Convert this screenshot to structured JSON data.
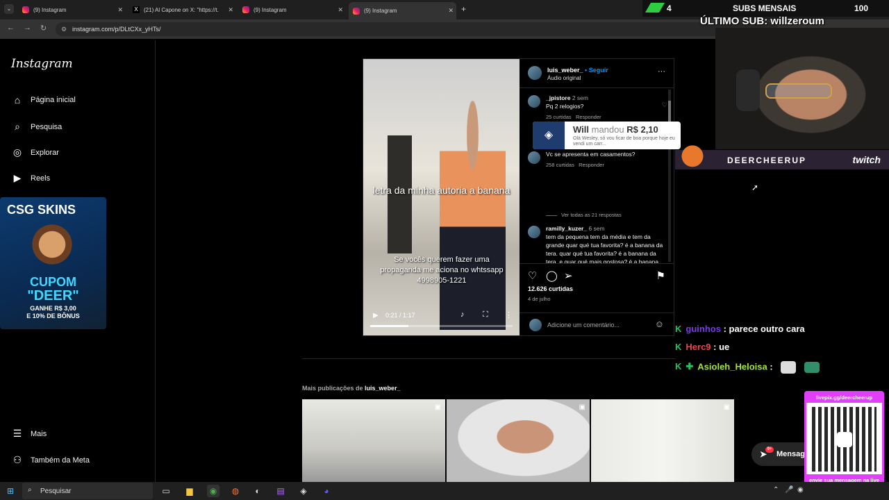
{
  "browser": {
    "tabs": [
      {
        "label": "(9) Instagram",
        "icon": "instagram-icon"
      },
      {
        "label": "(21) Al Capone on X: \"https://t.",
        "icon": "x-icon"
      },
      {
        "label": "(9) Instagram",
        "icon": "instagram-icon"
      },
      {
        "label": "(9) Instagram",
        "icon": "instagram-icon",
        "active": true
      }
    ],
    "url": "instagram.com/p/DLtCXx_yHTs/"
  },
  "overlay": {
    "subs_count": "4",
    "subs_label": "SUBS MENSAIS",
    "subs_goal": "100",
    "last_sub": "ÚLTIMO SUB: willzeroum",
    "channel": "DEERCHEERUP",
    "platform": "twitch",
    "donation": {
      "name": "Will",
      "verb": "mandou",
      "amount": "R$ 2,10",
      "message": "Olá Wesley, só vou ficar de boa porque hoje eu vendi um carr..."
    },
    "chat": [
      {
        "user": "guinhos",
        "color": "#7c3aed",
        "text": ": parece outro cara"
      },
      {
        "user": "Herc9",
        "color": "#ef4444",
        "text": ": ue"
      },
      {
        "user": "Asioleh_Heloisa",
        "color": "#a3e635",
        "text": ":"
      }
    ],
    "qr_top": "livepix.gg/deercheerup",
    "qr_bottom": "envie sua mensagem na live via pix!"
  },
  "sidebar": {
    "logo": "Instagram",
    "items": [
      {
        "label": "Página inicial",
        "icon": "home-icon"
      },
      {
        "label": "Pesquisa",
        "icon": "search-icon"
      },
      {
        "label": "Explorar",
        "icon": "compass-icon"
      },
      {
        "label": "Reels",
        "icon": "reels-icon"
      }
    ],
    "bottom": [
      {
        "label": "Mais",
        "icon": "menu-icon"
      },
      {
        "label": "Também da Meta",
        "icon": "meta-icon"
      }
    ]
  },
  "ad": {
    "title": "CSG SKINS",
    "cupom": "CUPOM",
    "code": "\"DEER\"",
    "bonus": "GANHE R$ 3,00\nE 10% DE BÔNUS"
  },
  "post": {
    "username": "luis_weber_",
    "follow": "Seguir",
    "audio": "Áudio original",
    "caption_main": "letra da minha autoria a banana",
    "caption_ad": "Se vocês querem fazer uma propaganda me aciona no whtssapp 4998905-1221",
    "video_time": "0:21 / 1:17",
    "video_progress": 0.27,
    "comments": [
      {
        "user": "_jpistore",
        "age": "2 sem",
        "text": "Pq 2 relogios?",
        "likes": "25 curtidas",
        "reply": "Responder"
      },
      {
        "user": "",
        "age": "",
        "text": "Vc se apresenta em casamentos?",
        "likes": "258 curtidas",
        "reply": "Responder"
      },
      {
        "user": "ramilly_kuzer_",
        "age": "6 sem",
        "text": "tem da pequena tem da média e tem da grande quar qué tua favorita? é a banana da tera. quar qué tua favorita? é a banana da tera. e quar qué mais gostosa? é a banana da prata. e a mais famosa? é a banana de ouro. vocês"
      }
    ],
    "see_all": "Ver todas as 21 respostas",
    "likes": "12.626 curtidas",
    "date": "4 de julho",
    "add_comment": "Adicione um comentário..."
  },
  "more": {
    "prefix": "Mais publicações de",
    "user": "luis_weber_"
  },
  "messages": {
    "label": "Mensag",
    "badge": "9+"
  },
  "taskbar": {
    "search": "Pesquisar"
  }
}
